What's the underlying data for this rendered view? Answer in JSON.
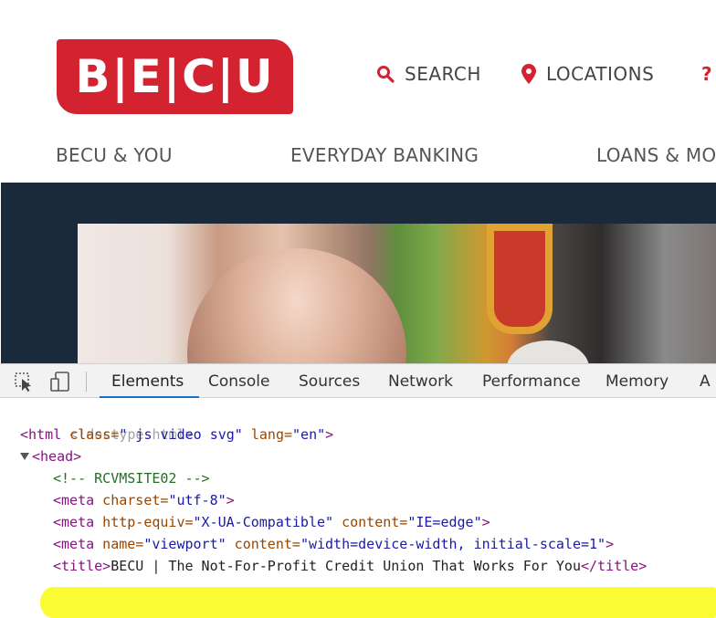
{
  "site": {
    "logo_text": "B|E|C|U",
    "utility": {
      "search": {
        "label": "SEARCH",
        "icon": "search-icon"
      },
      "locations": {
        "label": "LOCATIONS",
        "icon": "location-pin-icon"
      },
      "help": {
        "label": "?",
        "icon": "help-icon"
      }
    },
    "nav": [
      "BECU & YOU",
      "EVERYDAY BANKING",
      "LOANS & MO"
    ],
    "colors": {
      "brand_red": "#d32330",
      "hero_band": "#1a2a3b"
    }
  },
  "devtools": {
    "tools": [
      "inspect-element-icon",
      "device-emulation-icon"
    ],
    "tabs": [
      "Elements",
      "Console",
      "Sources",
      "Network",
      "Performance",
      "Memory",
      "A"
    ],
    "active_tab": "Elements",
    "code": {
      "doctype": "<!doctype html>",
      "html_tag_open": "<html",
      "html_attr1_name": " class=",
      "html_attr1_value": "\" js video svg\"",
      "html_attr2_name": " lang=",
      "html_attr2_value": "\"en\"",
      "html_tag_close": ">",
      "head_tag": "<head>",
      "comment": "<!-- RCVMSITE02 -->",
      "meta1_open": "<meta",
      "meta1_attr_name": " charset=",
      "meta1_attr_value": "\"utf-8\"",
      "meta1_close": ">",
      "meta2_open": "<meta",
      "meta2_attr1_name": " http-equiv=",
      "meta2_attr1_value": "\"X-UA-Compatible\"",
      "meta2_attr2_name": " content=",
      "meta2_attr2_value": "\"IE=edge\"",
      "meta2_close": ">",
      "meta3_open": "<meta",
      "meta3_attr1_name": " name=",
      "meta3_attr1_value": "\"viewport\"",
      "meta3_attr2_name": " content=",
      "meta3_attr2_value": "\"width=device-width, initial-scale=1\"",
      "meta3_close": ">",
      "title_open": "<title>",
      "title_text": "BECU | The Not-For-Profit Credit Union That Works For You",
      "title_close": "</title>"
    },
    "colors": {
      "highlight": "#fbfb34",
      "tab_underline": "#1a73c4"
    }
  }
}
